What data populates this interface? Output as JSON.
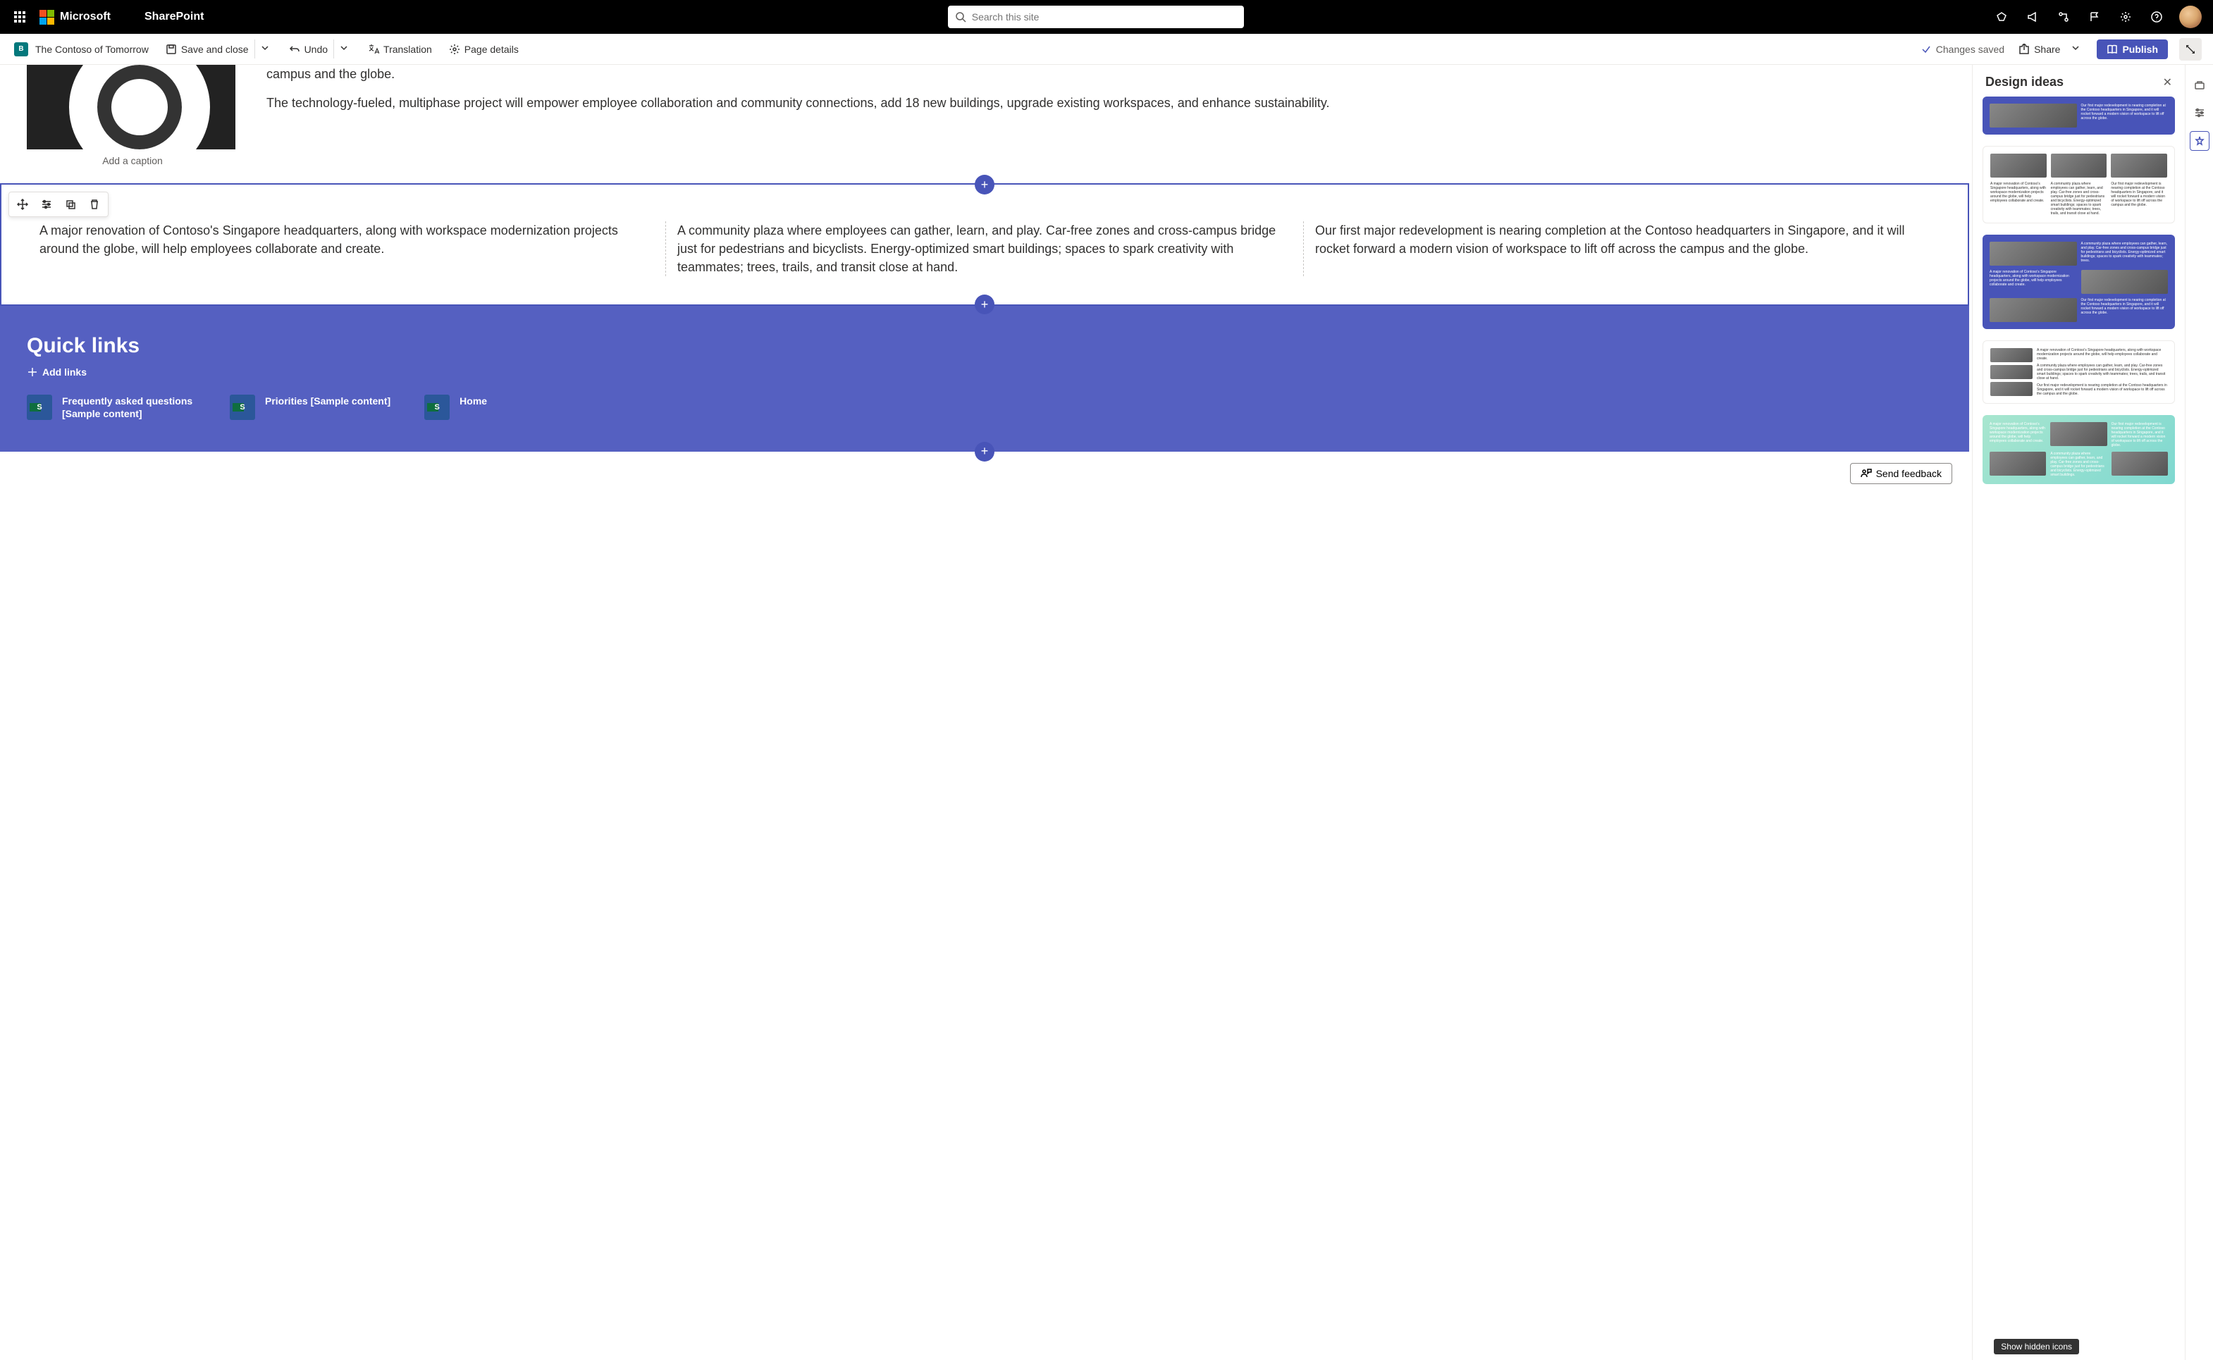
{
  "topbar": {
    "brand": "Microsoft",
    "app": "SharePoint",
    "search_placeholder": "Search this site"
  },
  "cmdbar": {
    "site_name": "The Contoso of Tomorrow",
    "save": "Save and close",
    "undo": "Undo",
    "translation": "Translation",
    "page_details": "Page details",
    "status": "Changes saved",
    "share": "Share",
    "publish": "Publish"
  },
  "hero": {
    "caption": "Add a caption",
    "p1_partial": "campus and the globe.",
    "p2": "The technology-fueled, multiphase project will empower employee collaboration and community connections, add 18 new buildings, upgrade existing workspaces, and enhance sustainability."
  },
  "columns": {
    "c1": "A major renovation of Contoso's Singapore headquarters, along with workspace modernization projects around the globe, will help employees collaborate and create.",
    "c2": "A community plaza where employees can gather, learn, and play. Car-free zones and cross-campus bridge just for pedestrians and bicyclists. Energy-optimized smart buildings; spaces to spark creativity with teammates; trees, trails, and transit close at hand.",
    "c3": "Our first major redevelopment is nearing completion at the Contoso headquarters in Singapore, and it will rocket forward a modern vision of workspace to lift off across the campus and the globe."
  },
  "quicklinks": {
    "title": "Quick links",
    "add": "Add links",
    "items": [
      {
        "label": "Frequently asked questions [Sample content]"
      },
      {
        "label": "Priorities [Sample content]"
      },
      {
        "label": "Home"
      }
    ]
  },
  "feedback": "Send feedback",
  "pane": {
    "title": "Design ideas"
  },
  "tooltip": "Show hidden icons"
}
